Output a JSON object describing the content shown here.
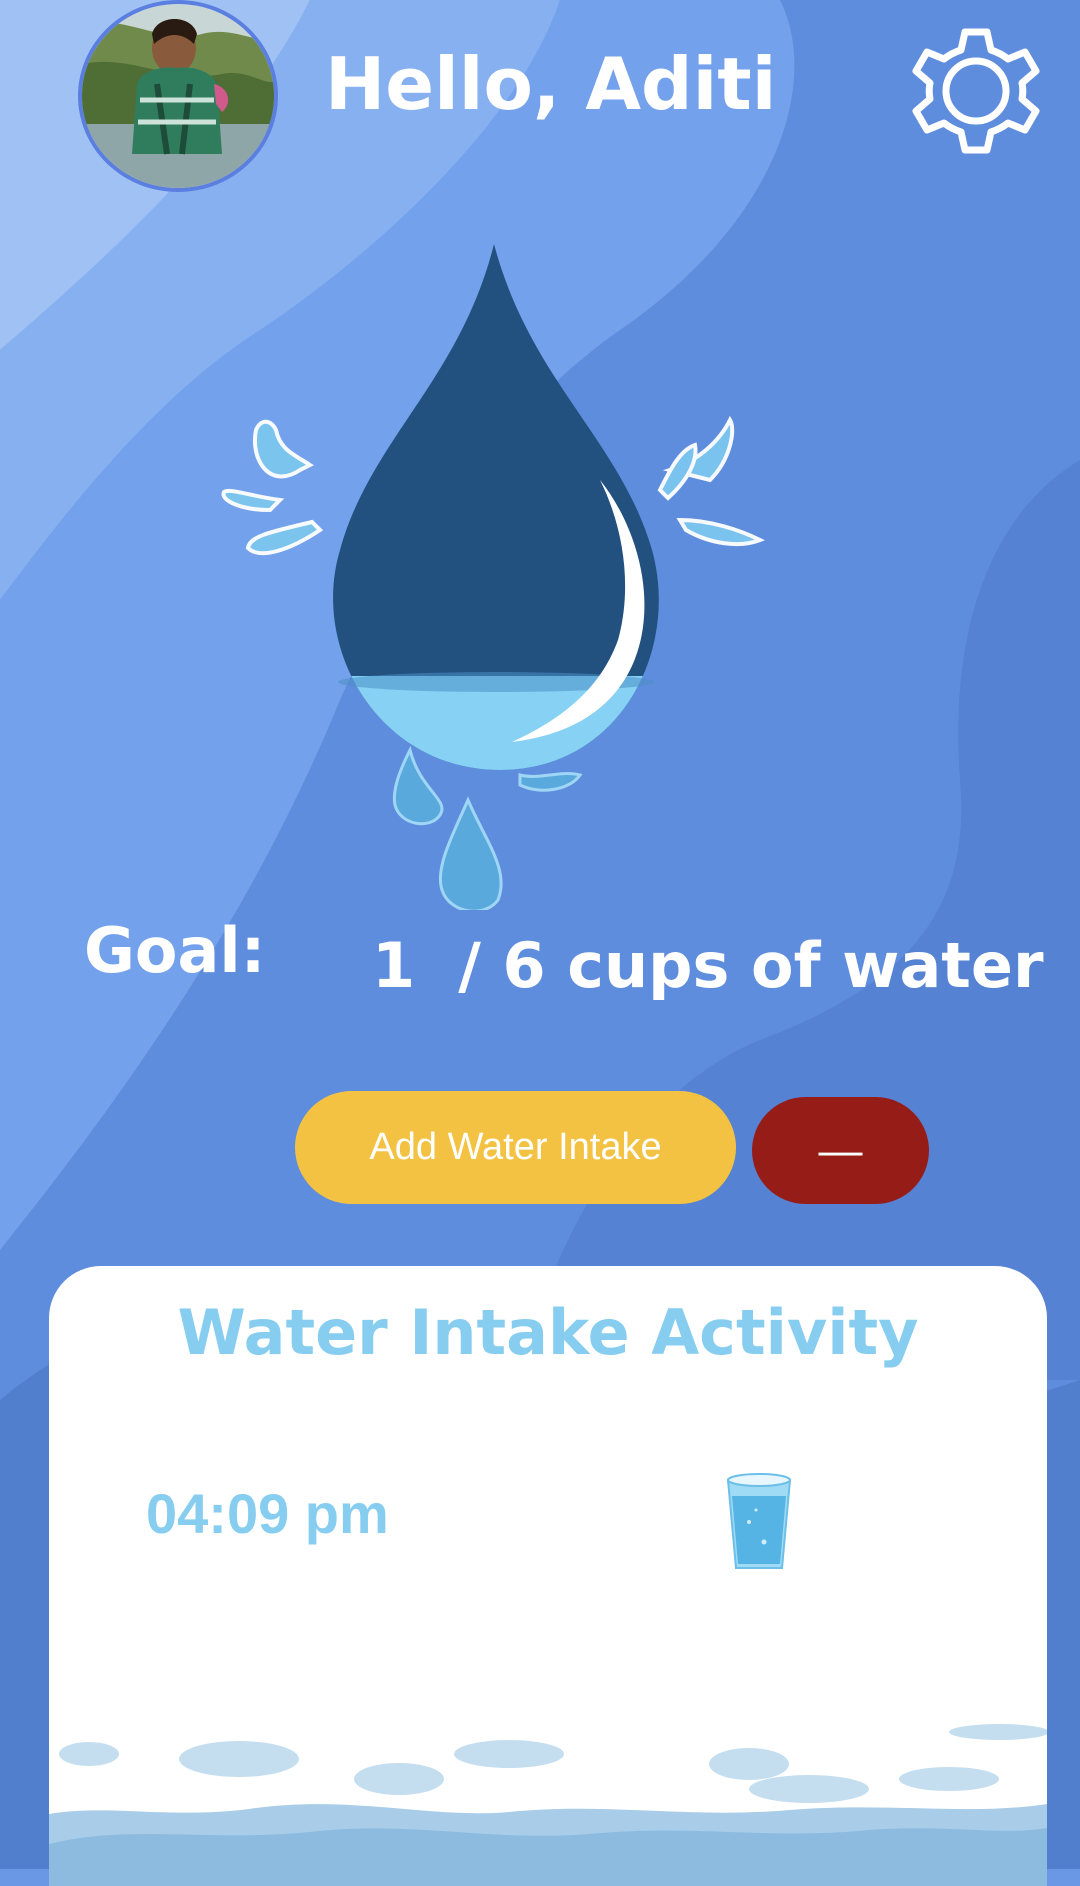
{
  "header": {
    "greeting": "Hello, Aditi",
    "avatar_icon": "user-photo-avatar",
    "settings_icon": "gear-icon"
  },
  "progress": {
    "goal_label": "Goal:",
    "current_cups": 1,
    "goal_cups": 6,
    "goal_text": "1  / 6 cups of water",
    "fill_fraction": 0.17
  },
  "actions": {
    "add_label": "Add Water Intake",
    "remove_label": "—"
  },
  "activity": {
    "title": "Water Intake Activity",
    "entries": [
      {
        "time": "04:09 pm",
        "icon": "water-glass-icon"
      }
    ]
  },
  "colors": {
    "background": "#6a98e4",
    "drop_dark": "#22507f",
    "drop_light": "#86d1f4",
    "add_button": "#f4c242",
    "remove_button": "#961d17",
    "accent_text": "#86cdf0"
  }
}
